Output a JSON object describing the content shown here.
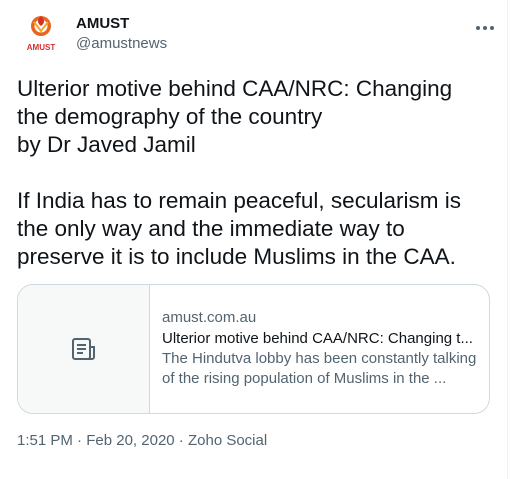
{
  "account": {
    "display_name": "AMUST",
    "handle": "@amustnews",
    "logo_text": "AMUST"
  },
  "tweet": {
    "text": "Ulterior motive behind CAA/NRC: Changing\nthe demography of the country\nby Dr Javed Jamil\n\nIf India has to remain peaceful, secularism is\nthe only way and the immediate way to\npreserve it is to include Muslims in the CAA."
  },
  "card": {
    "thumb_icon": "article-icon",
    "domain": "amust.com.au",
    "title": "Ulterior motive behind CAA/NRC: Changing t...",
    "desc_line1": "The Hindutva lobby has been constantly talking",
    "desc_line2": "of the rising population of Muslims in the ..."
  },
  "meta": {
    "time": "1:51 PM",
    "sep1": " · ",
    "date": "Feb 20, 2020",
    "sep2": " · ",
    "source": "Zoho Social"
  },
  "colors": {
    "text": "#0f1419",
    "secondary": "#536471",
    "border": "#cfd9de",
    "logo_orange": "#e8651c",
    "logo_red": "#d32f2f"
  }
}
